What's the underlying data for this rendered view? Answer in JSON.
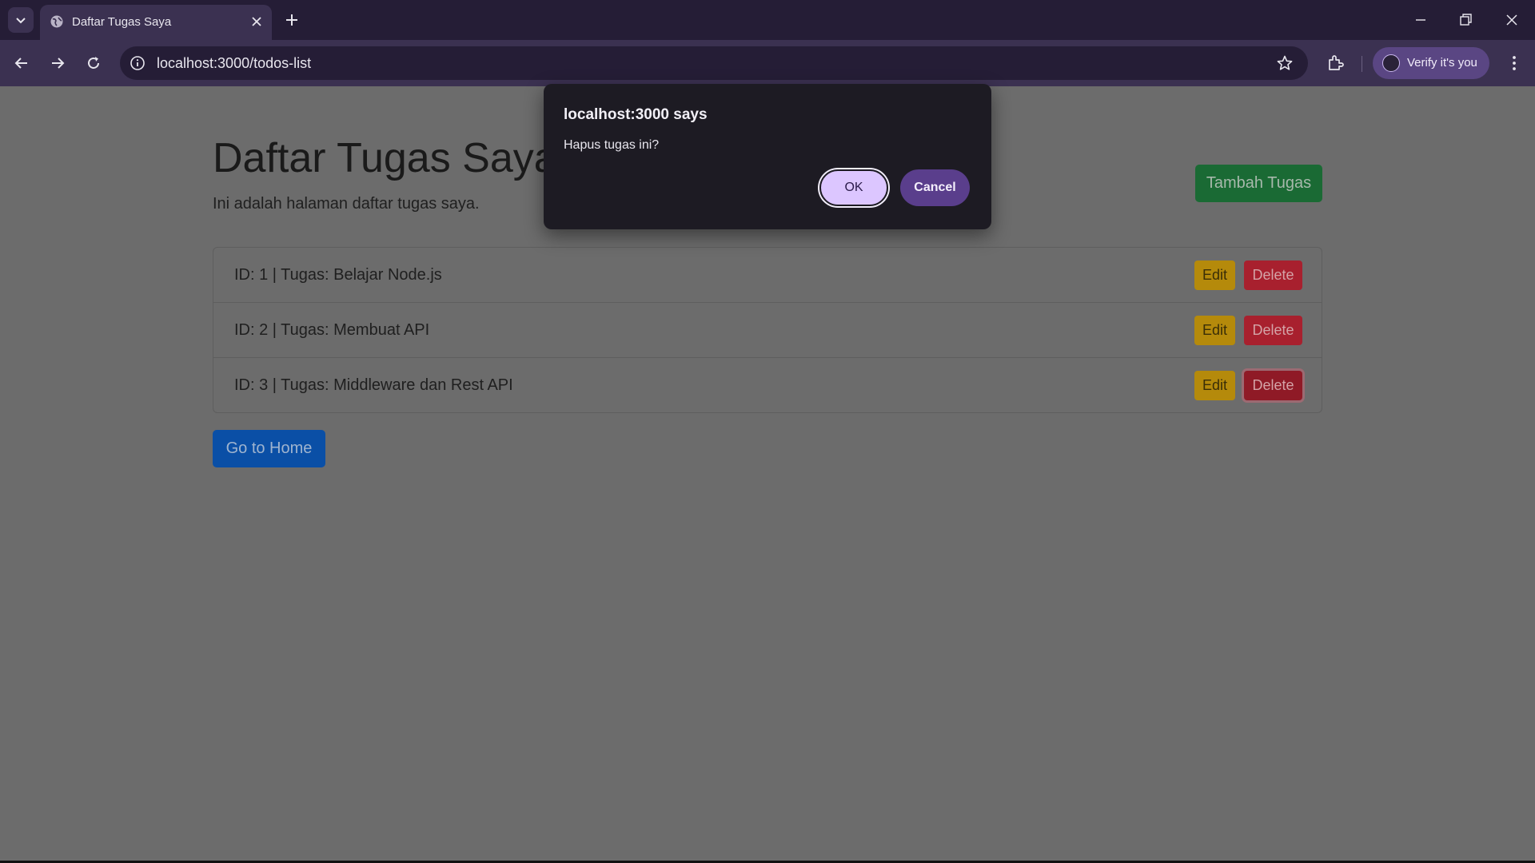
{
  "browser": {
    "tab_title": "Daftar Tugas Saya",
    "url": "localhost:3000/todos-list",
    "profile_label": "Verify it's you"
  },
  "page": {
    "title": "Daftar Tugas Saya",
    "subtitle": "Ini adalah halaman daftar tugas saya.",
    "add_button": "Tambah Tugas",
    "home_button": "Go to Home",
    "todos": [
      {
        "text": "ID: 1 | Tugas: Belajar Node.js",
        "edit": "Edit",
        "delete": "Delete"
      },
      {
        "text": "ID: 2 | Tugas: Membuat API",
        "edit": "Edit",
        "delete": "Delete"
      },
      {
        "text": "ID: 3 | Tugas: Middleware dan Rest API",
        "edit": "Edit",
        "delete": "Delete"
      }
    ]
  },
  "dialog": {
    "title": "localhost:3000 says",
    "message": "Hapus tugas ini?",
    "ok_label": "OK",
    "cancel_label": "Cancel"
  },
  "colors": {
    "accent": "#dcc6ff",
    "chrome": "#3b3151",
    "danger": "#a8202e",
    "warning": "#b58a0b",
    "success": "#1a6a34",
    "primary": "#0a4fa6"
  }
}
